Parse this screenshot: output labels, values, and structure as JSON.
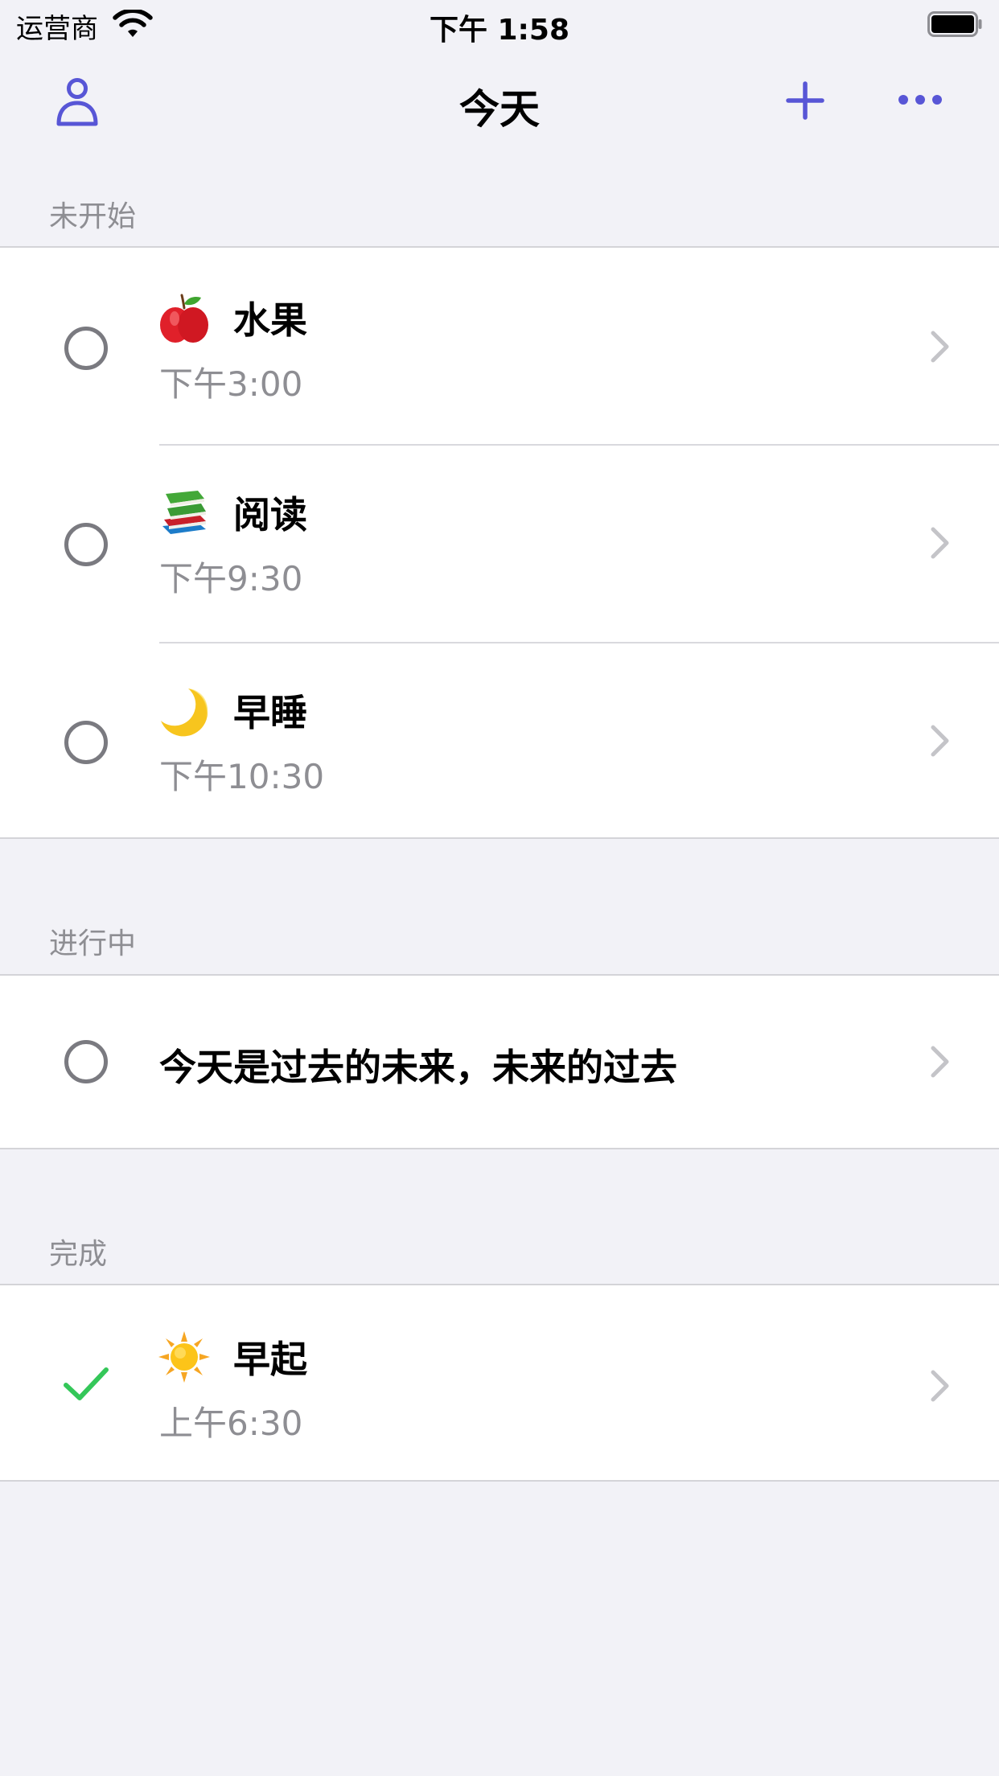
{
  "status_bar": {
    "carrier": "运营商",
    "time": "下午 1:58",
    "wifi_icon": "wifi-icon",
    "battery_icon": "battery-icon"
  },
  "nav": {
    "title": "今天",
    "left_icon": "person-icon",
    "right_icons": [
      "plus-icon",
      "more-icon"
    ]
  },
  "accent_color": "#5856d6",
  "sections": [
    {
      "header": "未开始",
      "items": [
        {
          "emoji": "apple-emoji",
          "title": "水果",
          "time": "下午3:00",
          "done": false
        },
        {
          "emoji": "books-emoji",
          "title": "阅读",
          "time": "下午9:30",
          "done": false
        },
        {
          "emoji": "moon-emoji",
          "title": "早睡",
          "time": "下午10:30",
          "done": false
        }
      ]
    },
    {
      "header": "进行中",
      "items": [
        {
          "title": "今天是过去的未来，未来的过去",
          "done": false
        }
      ]
    },
    {
      "header": "完成",
      "items": [
        {
          "emoji": "sun-emoji",
          "title": "早起",
          "time": "上午6:30",
          "done": true
        }
      ]
    }
  ]
}
